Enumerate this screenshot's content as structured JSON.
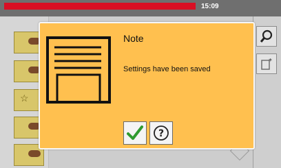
{
  "status_bar": {
    "time": "15:09"
  },
  "dialog": {
    "title": "Note",
    "message": "Settings have been saved",
    "confirm_icon": "checkmark-icon",
    "help_icon": "question-mark-icon"
  },
  "colors": {
    "dialog_bg": "#ffc04f",
    "progress_red": "#d90f24",
    "check_green": "#2f9a2f"
  }
}
